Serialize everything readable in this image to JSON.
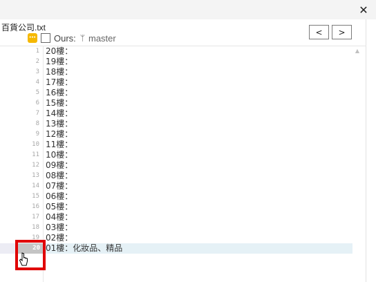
{
  "window": {
    "close_glyph": "✕"
  },
  "header": {
    "file_name": "百貨公司.txt",
    "conflict_badge_glyph": "⋯",
    "ours_label": "Ours:",
    "branch_icon_glyph": "ᛘ",
    "branch_name": "master",
    "prev_label": "<",
    "next_label": ">"
  },
  "editor": {
    "current_line": 20,
    "lines": [
      {
        "num": "1",
        "text": "20樓："
      },
      {
        "num": "2",
        "text": "19樓："
      },
      {
        "num": "3",
        "text": "18樓："
      },
      {
        "num": "4",
        "text": "17樓："
      },
      {
        "num": "5",
        "text": "16樓："
      },
      {
        "num": "6",
        "text": "15樓："
      },
      {
        "num": "7",
        "text": "14樓："
      },
      {
        "num": "8",
        "text": "13樓："
      },
      {
        "num": "9",
        "text": "12樓："
      },
      {
        "num": "10",
        "text": "11樓："
      },
      {
        "num": "11",
        "text": "10樓："
      },
      {
        "num": "12",
        "text": "09樓："
      },
      {
        "num": "13",
        "text": "08樓："
      },
      {
        "num": "14",
        "text": "07樓："
      },
      {
        "num": "15",
        "text": "06樓："
      },
      {
        "num": "16",
        "text": "05樓："
      },
      {
        "num": "17",
        "text": "04樓："
      },
      {
        "num": "18",
        "text": "03樓："
      },
      {
        "num": "19",
        "text": "02樓："
      },
      {
        "num": "20",
        "text": "01樓：化妝品、精品"
      }
    ]
  },
  "scrollbar": {
    "up_glyph": "▲"
  },
  "colors": {
    "annotation_box": "#e00000",
    "conflict_badge": "#f5b800",
    "current_line_bg": "#e5f1f6",
    "current_line_number_bg": "#c4c4c4"
  }
}
